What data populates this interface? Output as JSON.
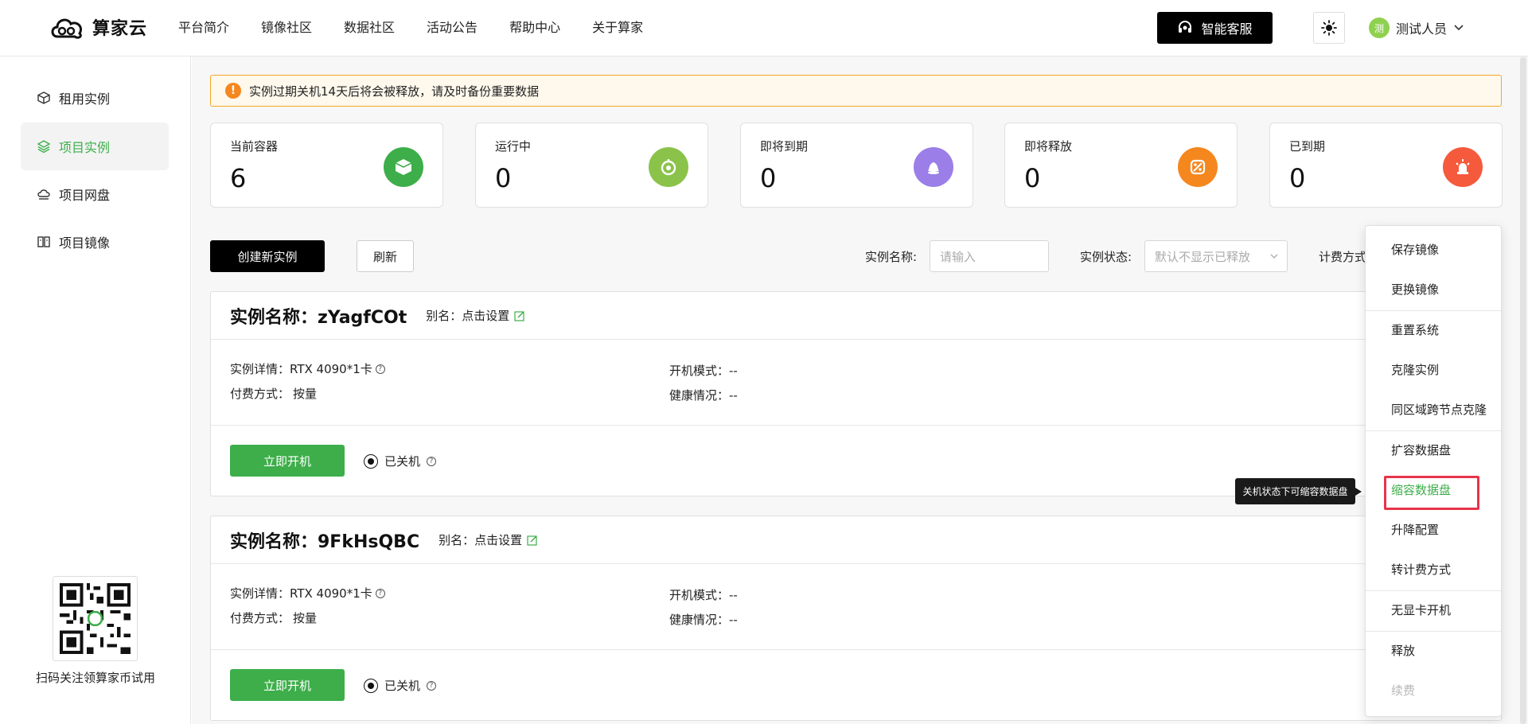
{
  "brand": {
    "name": "算家云"
  },
  "nav": [
    "平台简介",
    "镜像社区",
    "数据社区",
    "活动公告",
    "帮助中心",
    "关于算家"
  ],
  "header": {
    "service_label": "智能客服",
    "user_name": "测试人员",
    "avatar_text": "测"
  },
  "sidebar": {
    "items": [
      {
        "label": "租用实例",
        "icon": "cube-icon"
      },
      {
        "label": "项目实例",
        "icon": "layers-icon",
        "active": true
      },
      {
        "label": "项目网盘",
        "icon": "cloud-disk-icon"
      },
      {
        "label": "项目镜像",
        "icon": "image-icon"
      }
    ],
    "qr_caption": "扫码关注领算家币试用"
  },
  "notice": "实例过期关机14天后将会被释放，请及时备份重要数据",
  "stats": [
    {
      "label": "当前容器",
      "value": "6",
      "color": "#3dae4a"
    },
    {
      "label": "运行中",
      "value": "0",
      "color": "#8bc34a"
    },
    {
      "label": "即将到期",
      "value": "0",
      "color": "#9b7ee8"
    },
    {
      "label": "即将释放",
      "value": "0",
      "color": "#f5871f"
    },
    {
      "label": "已到期",
      "value": "0",
      "color": "#f55a3c"
    }
  ],
  "toolbar": {
    "create_label": "创建新实例",
    "refresh_label": "刷新",
    "name_filter_label": "实例名称:",
    "name_filter_placeholder": "请输入",
    "status_filter_label": "实例状态:",
    "status_filter_value": "默认不显示已释放",
    "billing_filter_label": "计费方式"
  },
  "instances": [
    {
      "title": "实例名称：zYagfCOt",
      "alias_label": "别名：点击设置",
      "detail_label": "实例详情：RTX 4090*1卡",
      "billing_label": "付费方式：",
      "billing_value": "按量",
      "boot_mode": "开机模式：--",
      "health": "健康情况：--",
      "start_label": "立即开机",
      "status_label": "已关机"
    },
    {
      "title": "实例名称：9FkHsQBC",
      "alias_label": "别名：点击设置",
      "detail_label": "实例详情：RTX 4090*1卡",
      "billing_label": "付费方式：",
      "billing_value": "按量",
      "boot_mode": "开机模式：--",
      "health": "健康情况：--",
      "start_label": "立即开机",
      "status_label": "已关机"
    }
  ],
  "menu": {
    "items": [
      "保存镜像",
      "更换镜像",
      "重置系统",
      "克隆实例",
      "同区域跨节点克隆",
      "扩容数据盘",
      "缩容数据盘",
      "升降配置",
      "转计费方式",
      "无显卡开机",
      "释放",
      "续费"
    ],
    "active_item": "缩容数据盘",
    "disabled_item": "续费"
  },
  "tooltip": "关机状态下可缩容数据盘"
}
